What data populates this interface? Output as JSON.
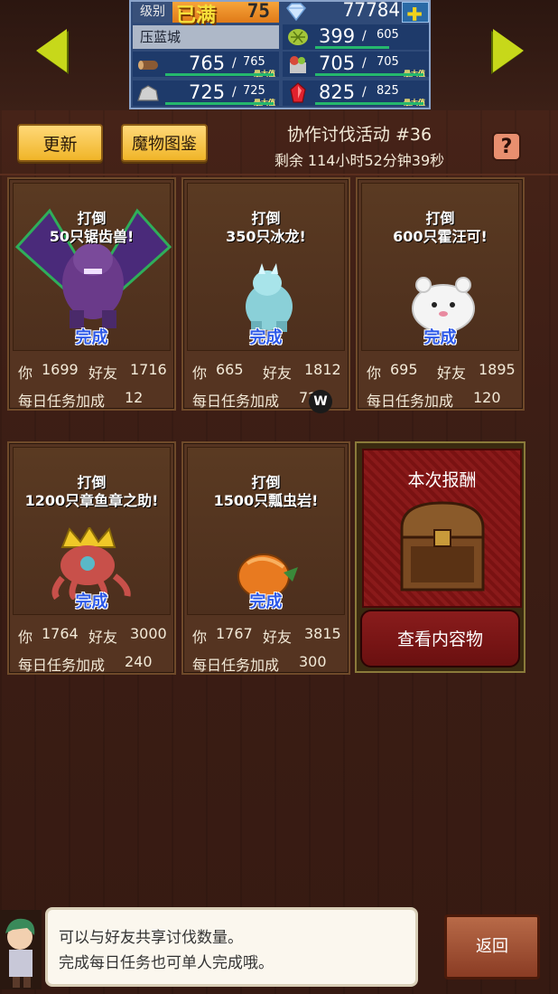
{
  "status": {
    "level_label": "级别",
    "level_full": "已满",
    "level_value": "75",
    "gems": "77784",
    "plus_label": "✚",
    "town_name": "压蓝城",
    "max_label": "最大值",
    "resources": [
      {
        "icon": "wood-icon",
        "value": "765",
        "max": "765"
      },
      {
        "icon": "grain-icon",
        "value": "399",
        "max": "605"
      },
      {
        "icon": "food-basket-icon",
        "value": "705",
        "max": "705"
      },
      {
        "icon": "ore-icon",
        "value": "725",
        "max": "725"
      },
      {
        "icon": "red-crystal-icon",
        "value": "825",
        "max": "825"
      }
    ]
  },
  "header": {
    "update_label": "更新",
    "monster_book_label": "魔物图鉴",
    "event_title": "协作讨伐活动 #36",
    "event_timer": "剩余 114小时52分钟39秒",
    "help_label": "?"
  },
  "quests": [
    {
      "line1": "打倒",
      "line2": "50只锯齿兽!",
      "status": "完成",
      "you_label": "你",
      "you": "1699",
      "friends_label": "好友",
      "friends": "1716",
      "bonus_label": "每日任务加成",
      "bonus": "12",
      "monster": "sawtooth-beast-sprite"
    },
    {
      "line1": "打倒",
      "line2": "350只冰龙!",
      "status": "完成",
      "you_label": "你",
      "you": "665",
      "friends_label": "好友",
      "friends": "1812",
      "bonus_label": "每日任务加成",
      "bonus": "72",
      "monster": "ice-dragon-sprite"
    },
    {
      "line1": "打倒",
      "line2": "600只霍汪可!",
      "status": "完成",
      "you_label": "你",
      "you": "695",
      "friends_label": "好友",
      "friends": "1895",
      "bonus_label": "每日任务加成",
      "bonus": "120",
      "monster": "white-beast-sprite"
    },
    {
      "line1": "打倒",
      "line2": "1200只章鱼章之助!",
      "status": "完成",
      "you_label": "你",
      "you": "1764",
      "friends_label": "好友",
      "friends": "3000",
      "bonus_label": "每日任务加成",
      "bonus": "240",
      "monster": "octopus-king-sprite"
    },
    {
      "line1": "打倒",
      "line2": "1500只瓢虫岩!",
      "status": "完成",
      "you_label": "你",
      "you": "1767",
      "friends_label": "好友",
      "friends": "3815",
      "bonus_label": "每日任务加成",
      "bonus": "300",
      "monster": "ladybug-rock-sprite"
    }
  ],
  "reward": {
    "title": "本次报酬",
    "button_label": "查看内容物"
  },
  "dialog": {
    "line1": "可以与好友共享讨伐数量。",
    "line2": "完成每日任务也可单人完成哦。"
  },
  "back_label": "返回",
  "watermark": "W"
}
